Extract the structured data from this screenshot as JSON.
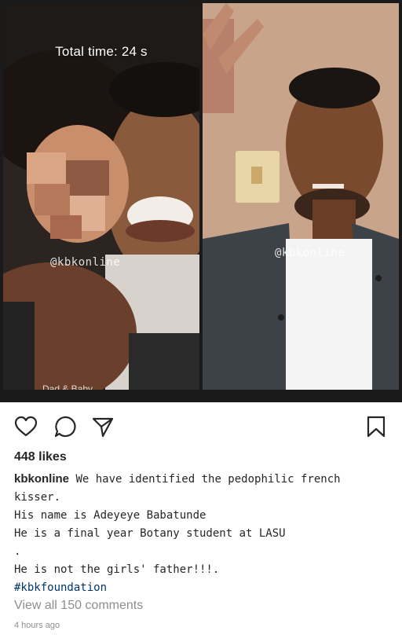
{
  "post": {
    "image": {
      "left_timer": "Total time: 24 s",
      "left_watermark": "@kbkonline",
      "right_watermark": "@kbkonline",
      "left_bottom_text": "Dad & Baby"
    },
    "actions": {
      "like_icon": "heart-icon",
      "comment_icon": "comment-icon",
      "share_icon": "share-icon",
      "save_icon": "bookmark-icon"
    },
    "likes": "448 likes",
    "caption": {
      "username": "kbkonline",
      "line1": " We have identified the pedophilic french",
      "line2": "kisser.",
      "line3": "His name is Adeyeye Babatunde",
      "line4": "He is a final year Botany student at LASU",
      "line5": ".",
      "line6": "He is not the girls' father!!!.",
      "hashtag": "#kbkfoundation"
    },
    "view_comments": "View all 150 comments",
    "time_ago": "4 hours ago"
  }
}
